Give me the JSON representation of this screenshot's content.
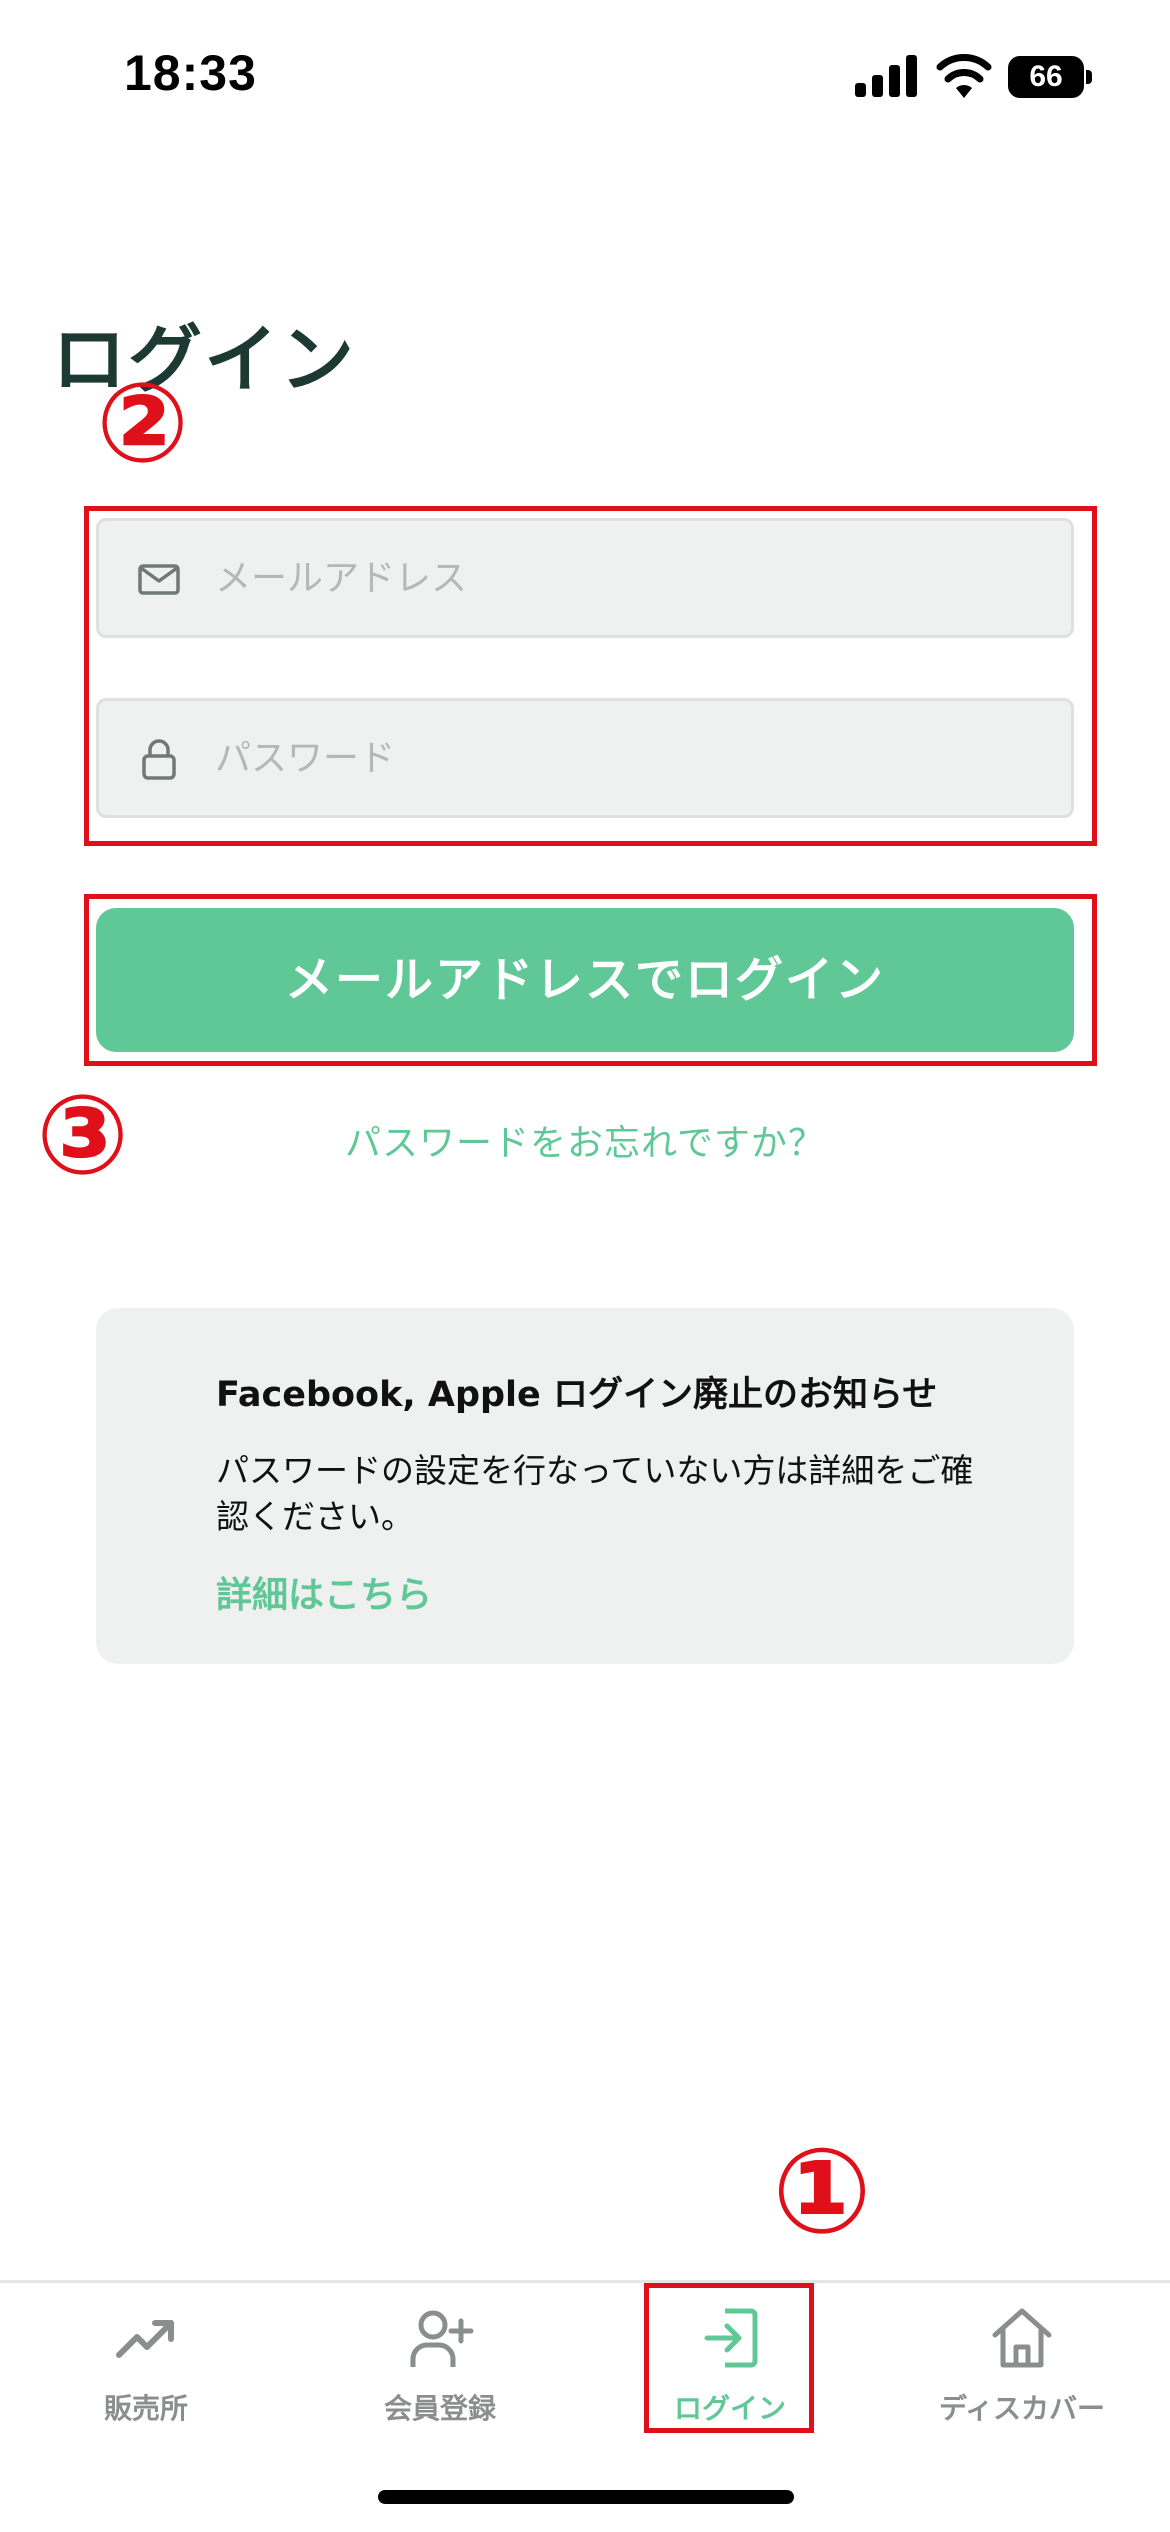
{
  "status_bar": {
    "time": "18:33",
    "battery": "66"
  },
  "page": {
    "title": "ログイン"
  },
  "annotations": {
    "marker_1": "①",
    "marker_2": "②",
    "marker_3": "③",
    "marker_color": "#e0101a"
  },
  "form": {
    "email_placeholder": "メールアドレス",
    "email_value": "",
    "password_placeholder": "パスワード",
    "password_value": "",
    "submit_label": "メールアドレスでログイン",
    "forgot_label": "パスワードをお忘れですか？"
  },
  "notice": {
    "title": "Facebook, Apple ログイン廃止のお知らせ",
    "body": "パスワードの設定を行なっていない方は詳細をご確認ください。",
    "link": "詳細はこちら"
  },
  "tab_bar": {
    "items": [
      {
        "label": "販売所",
        "icon": "trending-up-icon",
        "active": false
      },
      {
        "label": "会員登録",
        "icon": "user-plus-icon",
        "active": false
      },
      {
        "label": "ログイン",
        "icon": "login-icon",
        "active": true
      },
      {
        "label": "ディスカバー",
        "icon": "home-icon",
        "active": false
      }
    ]
  },
  "colors": {
    "accent": "#60c897",
    "title": "#1c3a31",
    "field_bg": "#eff0f0",
    "inactive_tab": "#8a8f8d"
  }
}
